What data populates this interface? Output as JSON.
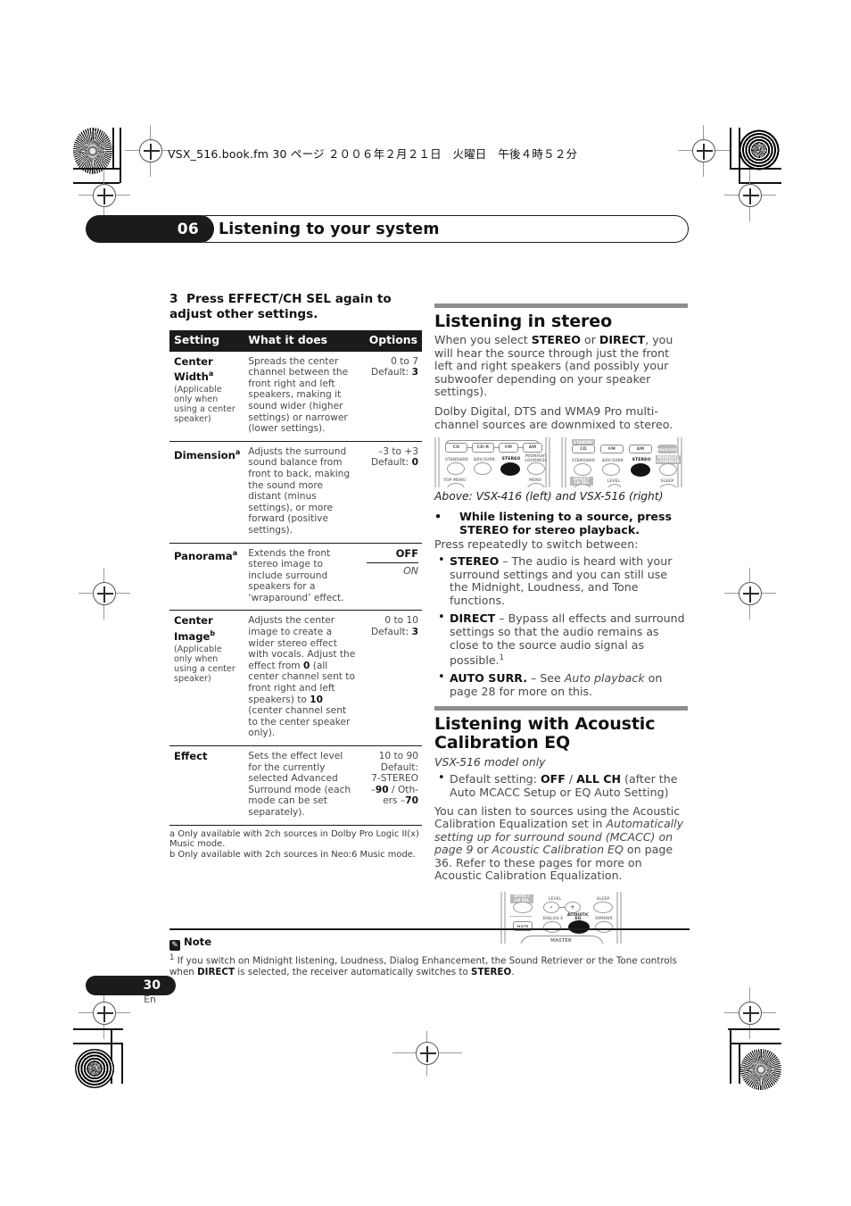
{
  "print_header": {
    "file_line": "VSX_516.book.fm  30 ページ  ２００６年２月２１日　火曜日　午後４時５２分"
  },
  "chapter": {
    "number": "06",
    "title": "Listening to your system"
  },
  "left_column": {
    "step": {
      "number": "3",
      "text": "Press EFFECT/CH SEL again to adjust other settings."
    },
    "table": {
      "headers": [
        "Setting",
        "What it does",
        "Options"
      ],
      "rows": [
        {
          "setting": "Center Width",
          "sup": "a",
          "setting_note": "(Applicable only when using a center speaker)",
          "what": "Spreads the center channel between the front right and left speakers, making it sound wider (higher settings) or narrower (lower settings).",
          "options_range": "0 to 7",
          "options_default_label": "Default:",
          "options_default_value": "3"
        },
        {
          "setting": "Dimension",
          "sup": "a",
          "setting_note": "",
          "what": "Adjusts the surround sound balance from front to back, making the sound more distant (minus settings), or more forward (positive settings).",
          "options_range": "–3 to +3",
          "options_default_label": "Default:",
          "options_default_value": "0"
        },
        {
          "setting": "Panorama",
          "sup": "a",
          "setting_note": "",
          "what": "Extends the front stereo image to include surround speakers for a ‘wraparound’ effect.",
          "options_off": "OFF",
          "options_on": "ON"
        },
        {
          "setting": "Center Image",
          "sup": "b",
          "setting_note": "(Applicable only when using a center speaker)",
          "what_1": "Adjusts the center image to create a wider stereo effect with vocals. Adjust the effect from ",
          "what_b1": "0",
          "what_2": " (all center channel sent to front right and left speakers) to ",
          "what_b2": "10",
          "what_3": " (center channel sent to the center speaker only).",
          "options_range": "0 to 10",
          "options_default_label": "Default:",
          "options_default_value": "3"
        },
        {
          "setting": "Effect",
          "sup": "",
          "setting_note": "",
          "what": "Sets the effect level for the currently selected Advanced Surround mode (each mode can be set separately).",
          "options_range": "10 to 90",
          "options_default_label": "Default:",
          "options_line2": "7-STEREO",
          "options_line3_pre": "–",
          "options_line3_b": "90",
          "options_line3_post": " / Oth-",
          "options_line4_pre": "ers –",
          "options_line4_b": "70"
        }
      ],
      "footnotes": [
        "a  Only available with 2ch sources in Dolby Pro Logic II(x) Music mode.",
        "b  Only available with 2ch sources in Neo:6 Music mode."
      ]
    }
  },
  "right_column": {
    "section_stereo": {
      "title": "Listening in stereo",
      "para1_pre": "When you select ",
      "para1_b1": "STEREO",
      "para1_mid": " or ",
      "para1_b2": "DIRECT",
      "para1_post": ", you will hear the source through just the front left and right speakers (and possibly your subwoofer depending on your speaker settings).",
      "para2": "Dolby Digital, DTS and WMA9 Pro multi-channel sources are downmixed to stereo.",
      "figure_caption": "Above: VSX-416 (left) and VSX-516 (right)",
      "lead_bullet": "While listening to a source, press STEREO for stereo playback.",
      "lead_intro": "Press repeatedly to switch between:",
      "bullets": [
        {
          "bold": "STEREO",
          "text": " – The audio is heard with your surround settings and you can still use the Midnight, Loudness, and Tone functions."
        },
        {
          "bold": "DIRECT",
          "text": " – Bypass all effects and surround settings so that the audio remains as close to the source audio signal as possible.",
          "footnote_ref": "1"
        },
        {
          "bold": "AUTO SURR.",
          "text_pre": " – See ",
          "italic": "Auto playback",
          "text_post": " on page 28 for more on this."
        }
      ]
    },
    "section_eq": {
      "title_line1": "Listening with Acoustic",
      "title_line2": "Calibration EQ",
      "model_note": "VSX-516 model only",
      "bullet_pre": "Default setting: ",
      "bullet_b1": "OFF",
      "bullet_mid": " / ",
      "bullet_b2": "ALL CH",
      "bullet_post": " (after the Auto MCACC Setup or EQ Auto Setting)",
      "para_1": "You can listen to sources using the Acoustic Calibration Equalization set in ",
      "para_i1": "Automatically setting up for surround sound (MCACC) on page 9",
      "para_2": " or ",
      "para_i2": "Acoustic Calibration EQ",
      "para_3": " on page 36. Refer to these pages for more on Acoustic Calibration Equalization."
    }
  },
  "remote_416": {
    "source_buttons": [
      "CD",
      "CD-R",
      "FM",
      "AM"
    ],
    "mode_labels": [
      "STANDARD",
      "ADV.SURR",
      "STEREO",
      "MIDNIGHT LOUDNESS"
    ],
    "selected": "STEREO",
    "bottom_labels": [
      "TOP MENU",
      "MENU"
    ]
  },
  "remote_516": {
    "source_buttons": [
      "CD",
      "FM",
      "AM",
      "RECEIVER"
    ],
    "source_top_label": "STANDBY",
    "mode_labels": [
      "STANDARD",
      "ADV.SURR",
      "STEREO",
      "MIDNIGHT LOUDNESS"
    ],
    "selected": "STEREO",
    "bottom_labels": [
      "EFFECT CH SEL",
      "LEVEL",
      "SLEEP"
    ]
  },
  "remote_eq": {
    "row1_labels": [
      "EFFECT CH SEL",
      "LEVEL",
      "SLEEP"
    ],
    "row2_labels": [
      "SURROUND MUTE",
      "DIALOG E",
      "ACOUSTIC EQ",
      "DIMMER"
    ],
    "selected": "ACOUSTIC EQ",
    "bottom_label": "MASTER",
    "level_minus": "–",
    "level_plus": "+"
  },
  "note": {
    "icon": "note-icon",
    "title": "Note",
    "marker": "1",
    "text_pre": " If you switch on Midnight listening, Loudness, Dialog Enhancement, the Sound Retriever or the Tone controls when ",
    "bold1": "DIRECT",
    "text_mid": " is selected, the receiver automatically switches to ",
    "bold2": "STEREO",
    "text_post": "."
  },
  "folio": {
    "page_number": "30",
    "language": "En"
  },
  "colors": {
    "ink": "#1b1b1b",
    "body_gray": "#4a4a4a",
    "rule_gray": "#8e8e8e"
  }
}
